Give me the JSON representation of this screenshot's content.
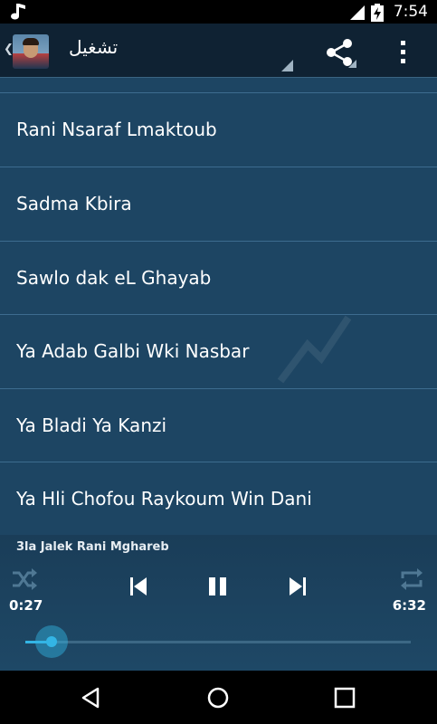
{
  "status_bar": {
    "time": "7:54",
    "icons": [
      "music-note-icon",
      "signal-icon",
      "battery-charging-icon"
    ]
  },
  "action_bar": {
    "title": "تشغيل",
    "icons": [
      "up-caret-icon",
      "app-icon",
      "share-icon",
      "overflow-menu-icon"
    ]
  },
  "song_list": {
    "items": [
      "Rani Nsaraf Lmaktoub",
      "Sadma Kbira",
      "Sawlo dak eL Ghayab",
      "Ya Adab Galbi Wki Nasbar",
      "Ya Bladi Ya Kanzi",
      "Ya Hli Chofou Raykoum Win Dani"
    ]
  },
  "player": {
    "title": "3la Jalek Rani Mghareb",
    "elapsed": "0:27",
    "duration": "6:32",
    "progress": 0.069,
    "icons": [
      "shuffle-icon",
      "previous-icon",
      "pause-icon",
      "next-icon",
      "repeat-icon"
    ]
  },
  "nav_bar": {
    "icons": [
      "back-icon",
      "home-icon",
      "recents-icon"
    ]
  },
  "colors": {
    "list_background": "#1d4563",
    "action_bar": "#0f2233",
    "accent": "#33b5e5",
    "divider": "#3d6c8f"
  }
}
